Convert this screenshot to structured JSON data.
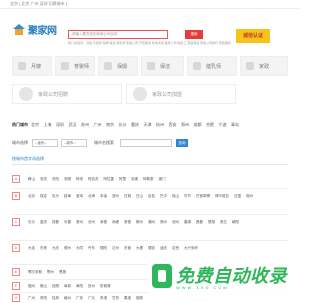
{
  "topbar": {
    "text": "北京 [ 北京 广州 深圳 切换城市 ]"
  },
  "header": {
    "logo_text": "聚家网",
    "search_placeholder": "请输入要查找的家政公司名称",
    "search_button": "搜索",
    "hot_text": "热门关键词：月嫂 育婴师 保姆 保洁 催乳师 家政公司 开荒保洁 家电清洗 搬家公司 钟点工 家庭保洁 家政公司排行 家政服务",
    "badge_text": "诚信认证"
  },
  "services": [
    {
      "label": "月嫂"
    },
    {
      "label": "育婴师"
    },
    {
      "label": "保姆"
    },
    {
      "label": "保洁"
    },
    {
      "label": "催乳师"
    },
    {
      "label": "家政"
    }
  ],
  "services2": [
    {
      "label": "家政公司招聘"
    },
    {
      "label": "家政公司加盟"
    }
  ],
  "citybar": {
    "title": "热门城市",
    "cities": [
      "北京",
      "上海",
      "深圳",
      "武汉",
      "苏州",
      "广州",
      "南京",
      "长沙",
      "重庆",
      "天津",
      "杭州",
      "西安",
      "郑州",
      "成都",
      "合肥",
      "宁波",
      "青岛"
    ]
  },
  "filter": {
    "label": "城市选择",
    "province": "--省份--",
    "city": "--城市--",
    "input_label": "城市名搜索",
    "button": "查询"
  },
  "section_title": "按城市首字母选择",
  "rows": [
    {
      "letter": "A",
      "cities": [
        "鞍山",
        "安庆",
        "安阳",
        "安顺",
        "阿坝",
        "阿克苏",
        "阿拉善",
        "阿里",
        "安康",
        "阿勒泰",
        "澳门"
      ]
    },
    {
      "letter": "B",
      "cities": [
        "北京",
        "保定",
        "包头",
        "蚌埠",
        "宝鸡",
        "北海",
        "本溪",
        "滨州",
        "白城",
        "白山",
        "百色",
        "巴中",
        "保山",
        "毕节",
        "巴音郭楞",
        "博尔塔拉",
        "白银",
        "亳州"
      ]
    },
    {
      "letter": "C",
      "cities": [
        "长沙",
        "重庆",
        "成都",
        "长春",
        "常州",
        "沧州",
        "承德",
        "赤峰",
        "常德",
        "郴州",
        "潮州",
        "滁州",
        "池州",
        "巢湖",
        "昌都",
        "楚雄",
        "崇左",
        "朝阳"
      ]
    },
    {
      "letter": "D",
      "cities": [
        "大连",
        "东莞",
        "大庆",
        "德州",
        "大同",
        "丹东",
        "德阳",
        "达州",
        "东营",
        "大理",
        "德宏",
        "迪庆",
        "定西",
        "大兴安岭"
      ]
    },
    {
      "letter": "E",
      "cities": [
        "鄂尔多斯",
        "鄂州",
        "恩施"
      ]
    },
    {
      "letter": "F",
      "cities": [
        "福州",
        "佛山",
        "抚顺",
        "阜新",
        "阜阳",
        "抚州",
        "防城港"
      ]
    },
    {
      "letter": "G",
      "cities": [
        "广州",
        "贵阳",
        "桂林",
        "赣州",
        "广安",
        "广元",
        "贵港",
        "甘孜",
        "果洛",
        "固原"
      ]
    }
  ],
  "watermark": {
    "text": "免费自动收录",
    "url": "WWW.XXX.COM"
  }
}
